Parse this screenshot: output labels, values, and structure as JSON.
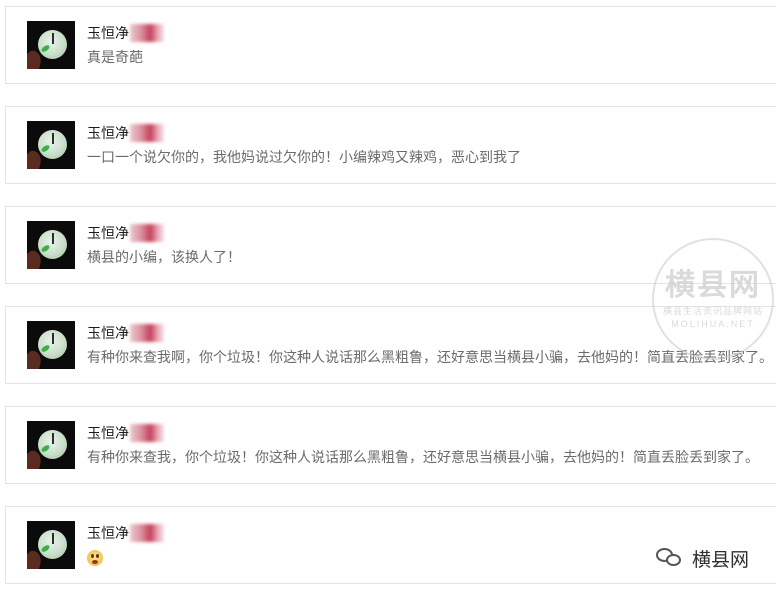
{
  "comments": [
    {
      "username": "玉恒净",
      "text": "真是奇葩"
    },
    {
      "username": "玉恒净",
      "text": "一口一个说欠你的，我他妈说过欠你的！小编辣鸡又辣鸡，恶心到我了"
    },
    {
      "username": "玉恒净",
      "text": "横县的小编，该换人了！"
    },
    {
      "username": "玉恒净",
      "text": "有种你来查我啊，你个垃圾！你这种人说话那么黑粗鲁，还好意思当横县小骗，去他妈的！简直丢脸丢到家了。"
    },
    {
      "username": "玉恒净",
      "text": "有种你来查我，你个垃圾！你这种人说话那么黑粗鲁，还好意思当横县小骗，去他妈的！简直丢脸丢到家了。"
    },
    {
      "username": "玉恒净",
      "text": "",
      "emoji": "shocked-face-emoji"
    }
  ],
  "watermark": {
    "title": "横县网",
    "subtitle": "横县生活资讯品牌网站",
    "domain": "MOLIHUA.NET"
  },
  "wechat_badge": {
    "icon": "wechat-icon",
    "label": "横县网"
  },
  "colors": {
    "username": "#1c1c1c",
    "comment_text": "#6b6b6b",
    "card_border": "#e4e4e4"
  }
}
